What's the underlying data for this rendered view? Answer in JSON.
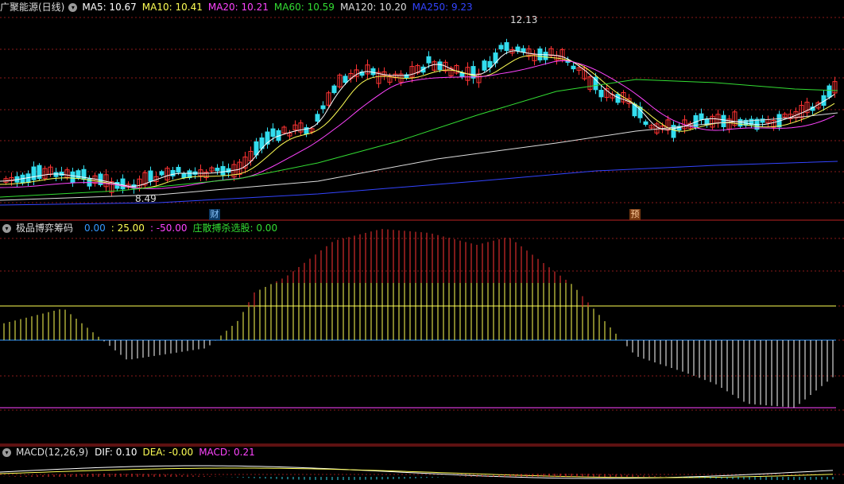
{
  "main": {
    "title": "广聚能源(日线)",
    "ma": [
      {
        "label": "MA5: 10.67",
        "color": "#ffffff"
      },
      {
        "label": "MA10: 10.41",
        "color": "#ffff55"
      },
      {
        "label": "MA20: 10.21",
        "color": "#ff44ff"
      },
      {
        "label": "MA60: 10.59",
        "color": "#33dd33"
      },
      {
        "label": "MA120: 10.20",
        "color": "#dddddd"
      },
      {
        "label": "MA250: 9.23",
        "color": "#3344ff"
      }
    ],
    "high_label": "12.13",
    "low_label": "8.49",
    "markers": [
      {
        "text": "财",
        "color": "#3399ff"
      },
      {
        "text": "预",
        "color": "#ff8833"
      }
    ]
  },
  "indicator": {
    "name": "极品博弈筹码",
    "values": [
      {
        "label": "0.00",
        "color": "#3399ff"
      },
      {
        "label": ": 25.00",
        "color": "#ffff55"
      },
      {
        "label": ": -50.00",
        "color": "#ff44ff"
      },
      {
        "label": "庄散搏杀选股: 0.00",
        "color": "#33dd33"
      }
    ]
  },
  "macd": {
    "name": "MACD(12,26,9)",
    "values": [
      {
        "label": "DIF: 0.10",
        "color": "#ffffff"
      },
      {
        "label": "DEA: -0.00",
        "color": "#ffff55"
      },
      {
        "label": "MACD: 0.21",
        "color": "#ff44ff"
      }
    ]
  },
  "colors": {
    "up": "#ff3333",
    "down": "#33ddee",
    "grid": "#8a1a1a",
    "ma5": "#ffffff",
    "ma10": "#ffff55",
    "ma20": "#ff44ff",
    "ma60": "#33dd33",
    "ma120": "#dddddd",
    "ma250": "#3344ff"
  }
}
